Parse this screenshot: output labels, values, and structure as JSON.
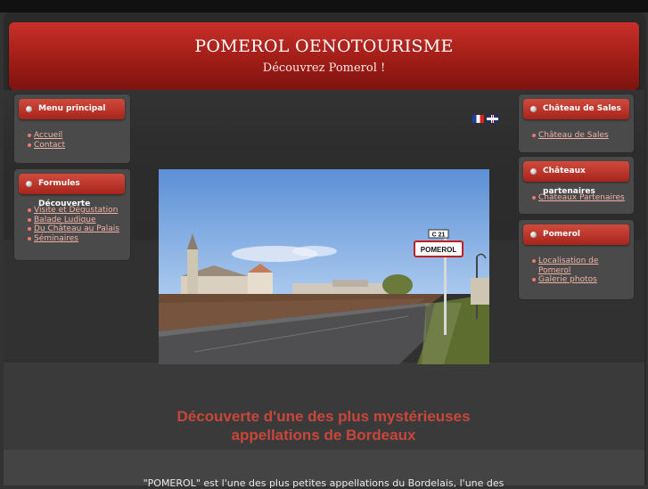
{
  "site": {
    "title": "POMEROL OENOTOURISME",
    "slogan": "Découvrez Pomerol !"
  },
  "languages": [
    {
      "code": "fr",
      "icon": "french-flag-icon"
    },
    {
      "code": "en",
      "icon": "uk-flag-icon"
    }
  ],
  "left_modules": {
    "menu": {
      "title": "Menu principal",
      "items": [
        "Accueil",
        "Contact"
      ]
    },
    "formules": {
      "title": "Formules Découverte",
      "items": [
        "Visite et Dégustation",
        "Balade Ludique",
        "Du Château au Palais",
        "Séminaires"
      ]
    }
  },
  "right_modules": {
    "sales": {
      "title": "Château de Sales",
      "items": [
        "Château de Sales"
      ]
    },
    "partenaires": {
      "title": "Châteaux partenaires",
      "items": [
        "Châteaux Partenaires"
      ]
    },
    "pomerol": {
      "title": "Pomerol",
      "items": [
        "Localisation de Pomerol",
        "Galerie photos"
      ]
    }
  },
  "photo": {
    "sign_route": "C 21",
    "sign_town": "POMEROL"
  },
  "content": {
    "headline_line1": "Découverte d'une des plus mystérieuses",
    "headline_line2": "appellations de Bordeaux",
    "intro": "\"POMEROL\" est l'une des plus petites appellations du Bordelais, l'une des"
  },
  "colors": {
    "header_red": "#b52620",
    "accent_link": "#f1b3a6",
    "headline_red": "#c9463a"
  }
}
